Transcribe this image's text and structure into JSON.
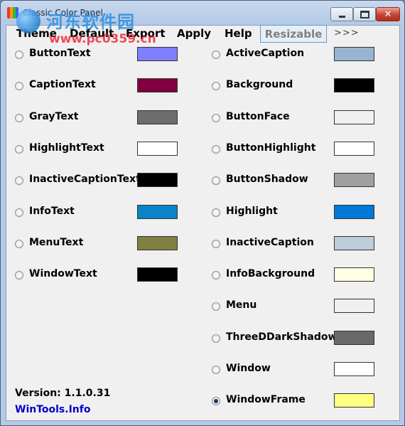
{
  "window": {
    "title": "Classic Color Panel",
    "close_glyph": "✕",
    "buttons": [
      "minimize-icon",
      "maximize-icon",
      "close-icon"
    ]
  },
  "watermark": {
    "cn_text": "河东软件园",
    "url": "www.pc0359.cn"
  },
  "menu": {
    "items": [
      "Theme",
      "Default",
      "Export",
      "Apply",
      "Help"
    ],
    "resizable": "Resizable",
    "more": ">>>"
  },
  "left_colors": [
    {
      "name": "ButtonText",
      "color": "#8080ff",
      "selected": false
    },
    {
      "name": "CaptionText",
      "color": "#80003f",
      "selected": false
    },
    {
      "name": "GrayText",
      "color": "#6d6d6d",
      "selected": false
    },
    {
      "name": "HighlightText",
      "color": "#ffffff",
      "selected": false
    },
    {
      "name": "InactiveCaptionText",
      "color": "#000000",
      "selected": false
    },
    {
      "name": "InfoText",
      "color": "#0a84c6",
      "selected": false
    },
    {
      "name": "MenuText",
      "color": "#808040",
      "selected": false
    },
    {
      "name": "WindowText",
      "color": "#000000",
      "selected": false
    }
  ],
  "right_colors": [
    {
      "name": "ActiveCaption",
      "color": "#99b4d1",
      "selected": false
    },
    {
      "name": "Background",
      "color": "#000000",
      "selected": false
    },
    {
      "name": "ButtonFace",
      "color": "#f0f0f0",
      "selected": false
    },
    {
      "name": "ButtonHighlight",
      "color": "#ffffff",
      "selected": false
    },
    {
      "name": "ButtonShadow",
      "color": "#a0a0a0",
      "selected": false
    },
    {
      "name": "Highlight",
      "color": "#0078d7",
      "selected": false
    },
    {
      "name": "InactiveCaption",
      "color": "#bfcddb",
      "selected": false
    },
    {
      "name": "InfoBackground",
      "color": "#ffffe1",
      "selected": false
    },
    {
      "name": "Menu",
      "color": "#f0f0f0",
      "selected": false
    },
    {
      "name": "ThreeDDarkShadow",
      "color": "#696969",
      "selected": false
    },
    {
      "name": "Window",
      "color": "#ffffff",
      "selected": false
    },
    {
      "name": "WindowFrame",
      "color": "#ffff80",
      "selected": true
    }
  ],
  "footer": {
    "version": "Version: 1.1.0.31",
    "link": "WinTools.Info"
  }
}
